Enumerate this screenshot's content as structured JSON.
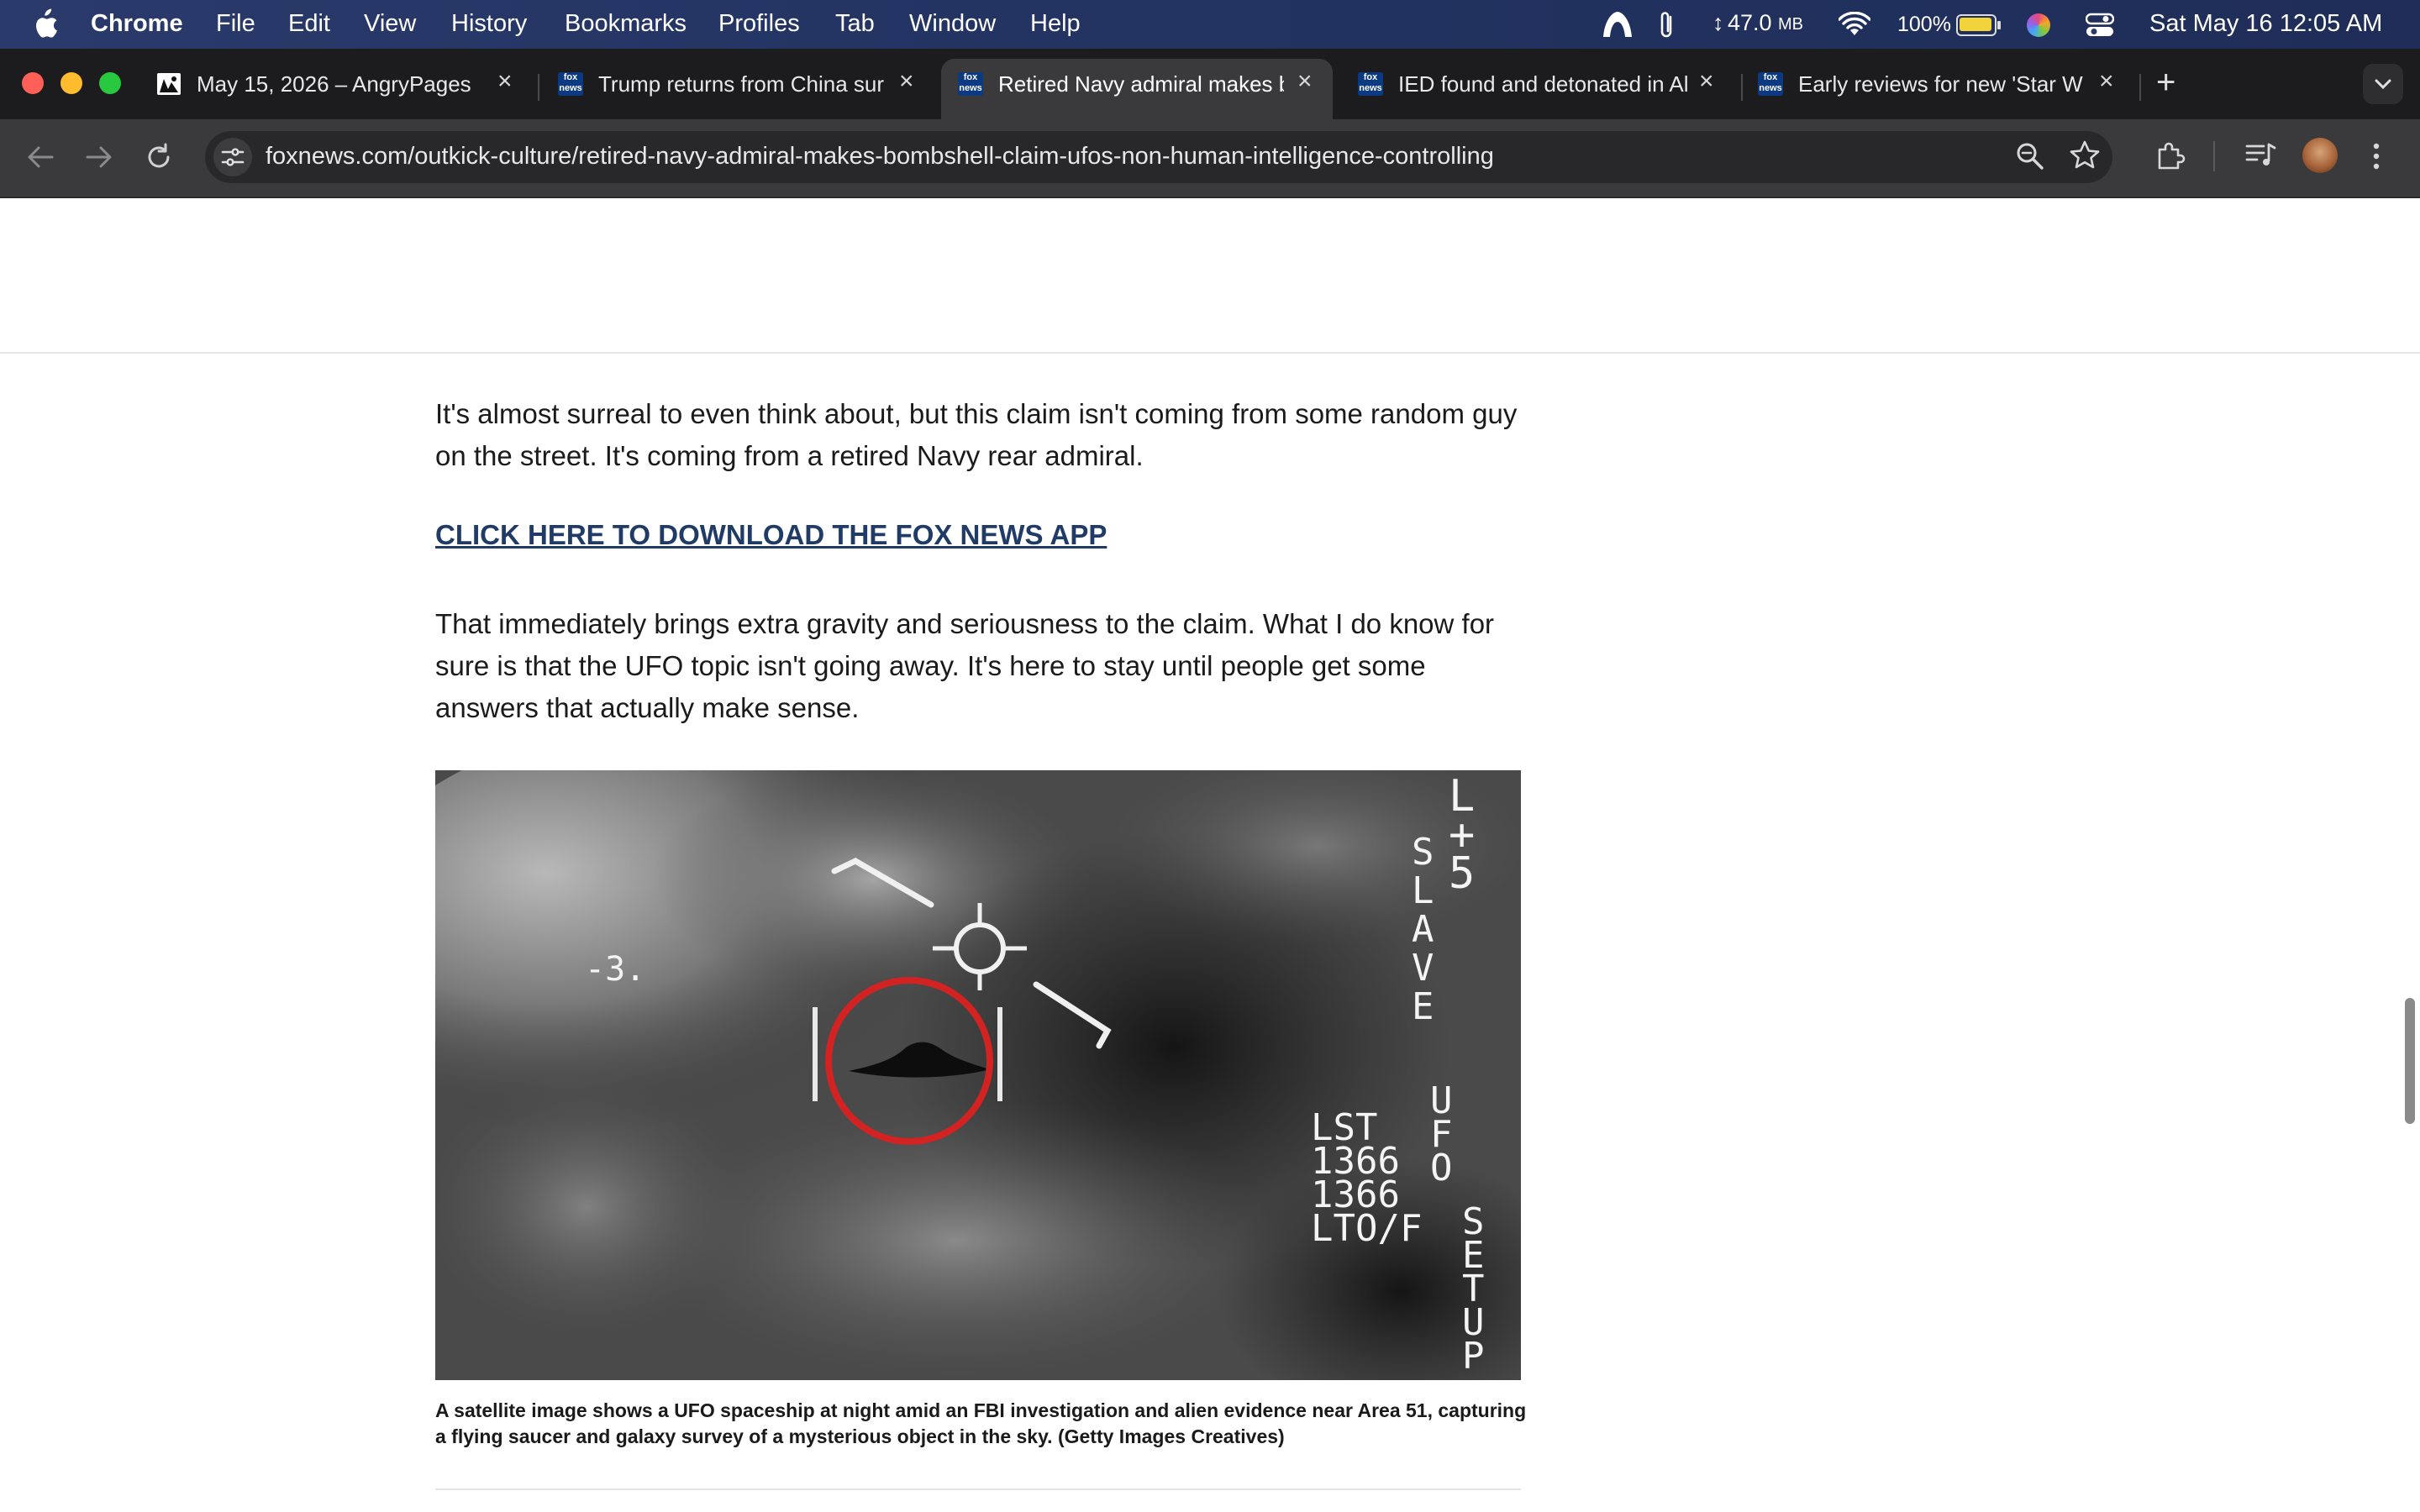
{
  "menubar": {
    "app_name": "Chrome",
    "items": [
      "File",
      "Edit",
      "View",
      "History",
      "Bookmarks",
      "Profiles",
      "Tab",
      "Window",
      "Help"
    ],
    "memory": "47.0",
    "memory_unit": "MB",
    "battery": "100%",
    "datetime": "Sat May 16  12:05 AM"
  },
  "tabs": [
    {
      "title": "May 15, 2026 – AngryPages",
      "active": false
    },
    {
      "title": "Trump returns from China sur",
      "active": false
    },
    {
      "title": "Retired Navy admiral makes b",
      "active": true
    },
    {
      "title": "IED found and detonated in Al",
      "active": false
    },
    {
      "title": "Early reviews for new 'Star W",
      "active": false
    }
  ],
  "favicon_text": {
    "fox": "fox",
    "news": "news"
  },
  "toolbar": {
    "url": "foxnews.com/outkick-culture/retired-navy-admiral-makes-bombshell-claim-ufos-non-human-intelligence-controlling"
  },
  "article": {
    "para1": "It's almost surreal to even think about, but this claim isn't coming from some random guy on the street. It's coming from a retired Navy rear admiral.",
    "app_link": "CLICK HERE TO DOWNLOAD THE FOX NEWS APP",
    "para2": "That immediately brings extra gravity and seriousness to the claim. What I do know for sure is that the UFO topic isn't going away. It's here to stay until people get some answers that actually make sense.",
    "image_overlay": {
      "left_reading": "-3.",
      "top_right_col1": [
        "L",
        "+",
        "5"
      ],
      "slave": [
        "S",
        "L",
        "A",
        "V",
        "E"
      ],
      "lst_block": [
        "LST",
        "1366",
        "1366",
        "LTO/F"
      ],
      "ufo": [
        "U",
        "F",
        "O"
      ],
      "setup": [
        "S",
        "E",
        "T",
        "U",
        "P"
      ]
    },
    "caption": "A satellite image shows a UFO spaceship at night amid an FBI investigation and alien evidence near Area 51, capturing a flying saucer and galaxy survey of a mysterious object in the sky. (Getty Images Creatives)"
  },
  "colors": {
    "link": "#1f3b66",
    "target_ring": "#d32222",
    "tab_strip": "#1c1c1e",
    "toolbar": "#3a3a3c"
  }
}
